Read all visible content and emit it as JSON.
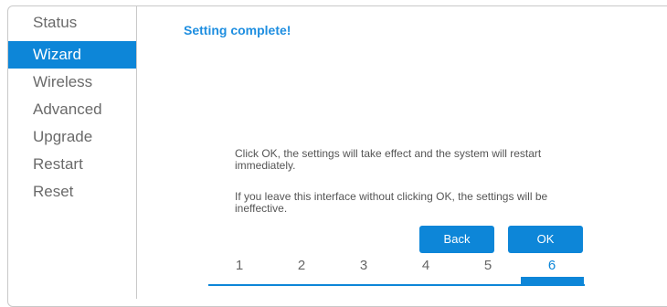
{
  "sidebar": {
    "items": [
      {
        "label": "Status",
        "active": false
      },
      {
        "label": "Wizard",
        "active": true
      },
      {
        "label": "Wireless",
        "active": false
      },
      {
        "label": "Advanced",
        "active": false
      },
      {
        "label": "Upgrade",
        "active": false
      },
      {
        "label": "Restart",
        "active": false
      },
      {
        "label": "Reset",
        "active": false
      }
    ]
  },
  "main": {
    "title": "Setting complete!",
    "message1": "Click OK, the settings will take effect and the system will restart immediately.",
    "message2": "If you leave this interface without clicking OK, the settings will be ineffective.",
    "back_label": "Back",
    "ok_label": "OK"
  },
  "steps": {
    "labels": [
      "1",
      "2",
      "3",
      "4",
      "5",
      "6"
    ],
    "current": 6
  },
  "colors": {
    "accent": "#0d86d8",
    "title": "#1e8ee0"
  }
}
